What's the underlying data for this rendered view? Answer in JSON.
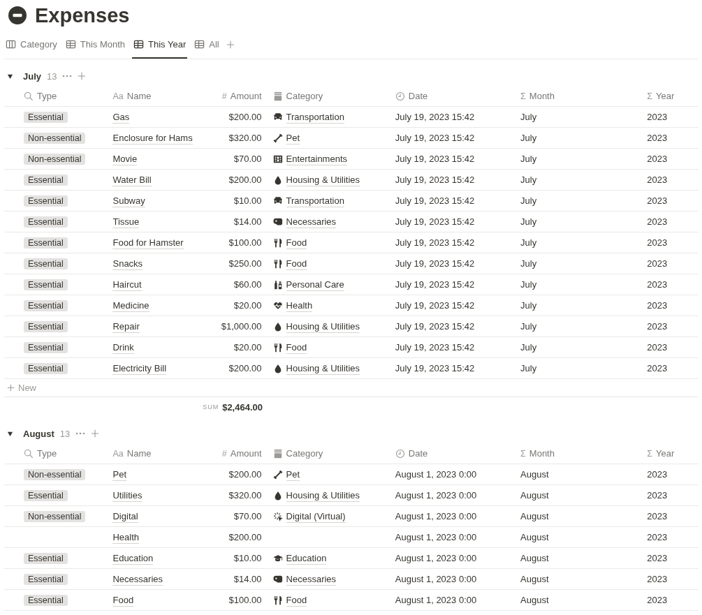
{
  "page": {
    "title": "Expenses"
  },
  "tabs": [
    {
      "label": "Category",
      "kind": "board",
      "selected": false
    },
    {
      "label": "This Month",
      "kind": "table",
      "selected": false
    },
    {
      "label": "This Year",
      "kind": "table",
      "selected": true
    },
    {
      "label": "All",
      "kind": "table",
      "selected": false
    }
  ],
  "groups": [
    {
      "title": "July",
      "count": "13",
      "expanded": true,
      "columns": [
        {
          "label": "Type",
          "kind": "search"
        },
        {
          "label": "Name",
          "kind": "text",
          "glyph": "Aa"
        },
        {
          "label": "Amount",
          "kind": "number",
          "glyph": "#"
        },
        {
          "label": "Category",
          "kind": "select"
        },
        {
          "label": "Date",
          "kind": "clock"
        },
        {
          "label": "Month",
          "kind": "formula",
          "glyph": "Σ"
        },
        {
          "label": "Year",
          "kind": "formula",
          "glyph": "Σ"
        }
      ],
      "new_label": "New",
      "sum": {
        "label": "SUM",
        "value": "$2,464.00"
      },
      "rows": [
        {
          "type": "Essential",
          "name": "Gas",
          "amount": "$200.00",
          "category": {
            "label": "Transportation",
            "kind": "car"
          },
          "date": "July 19, 2023 15:42",
          "month": "July",
          "year": "2023"
        },
        {
          "type": "Non-essential",
          "name": "Enclosure for Hams",
          "amount": "$320.00",
          "category": {
            "label": "Pet",
            "kind": "bone"
          },
          "date": "July 19, 2023 15:42",
          "month": "July",
          "year": "2023"
        },
        {
          "type": "Non-essential",
          "name": "Movie",
          "amount": "$70.00",
          "category": {
            "label": "Entertainments",
            "kind": "film"
          },
          "date": "July 19, 2023 15:42",
          "month": "July",
          "year": "2023"
        },
        {
          "type": "Essential",
          "name": "Water Bill",
          "amount": "$200.00",
          "category": {
            "label": "Housing & Utilities",
            "kind": "drop"
          },
          "date": "July 19, 2023 15:42",
          "month": "July",
          "year": "2023"
        },
        {
          "type": "Essential",
          "name": "Subway",
          "amount": "$10.00",
          "category": {
            "label": "Transportation",
            "kind": "car"
          },
          "date": "July 19, 2023 15:42",
          "month": "July",
          "year": "2023"
        },
        {
          "type": "Essential",
          "name": "Tissue",
          "amount": "$14.00",
          "category": {
            "label": "Necessaries",
            "kind": "roll"
          },
          "date": "July 19, 2023 15:42",
          "month": "July",
          "year": "2023"
        },
        {
          "type": "Essential",
          "name": "Food for Hamster",
          "amount": "$100.00",
          "category": {
            "label": "Food",
            "kind": "cutlery"
          },
          "date": "July 19, 2023 15:42",
          "month": "July",
          "year": "2023"
        },
        {
          "type": "Essential",
          "name": "Snacks",
          "amount": "$250.00",
          "category": {
            "label": "Food",
            "kind": "cutlery"
          },
          "date": "July 19, 2023 15:42",
          "month": "July",
          "year": "2023"
        },
        {
          "type": "Essential",
          "name": "Haircut",
          "amount": "$60.00",
          "category": {
            "label": "Personal Care",
            "kind": "bottles"
          },
          "date": "July 19, 2023 15:42",
          "month": "July",
          "year": "2023"
        },
        {
          "type": "Essential",
          "name": "Medicine",
          "amount": "$20.00",
          "category": {
            "label": "Health",
            "kind": "heart"
          },
          "date": "July 19, 2023 15:42",
          "month": "July",
          "year": "2023"
        },
        {
          "type": "Essential",
          "name": "Repair",
          "amount": "$1,000.00",
          "category": {
            "label": "Housing & Utilities",
            "kind": "drop"
          },
          "date": "July 19, 2023 15:42",
          "month": "July",
          "year": "2023"
        },
        {
          "type": "Essential",
          "name": "Drink",
          "amount": "$20.00",
          "category": {
            "label": "Food",
            "kind": "cutlery"
          },
          "date": "July 19, 2023 15:42",
          "month": "July",
          "year": "2023"
        },
        {
          "type": "Essential",
          "name": "Electricity Bill",
          "amount": "$200.00",
          "category": {
            "label": "Housing & Utilities",
            "kind": "drop"
          },
          "date": "July 19, 2023 15:42",
          "month": "July",
          "year": "2023"
        }
      ]
    },
    {
      "title": "August",
      "count": "13",
      "expanded": true,
      "columns": [
        {
          "label": "Type",
          "kind": "search"
        },
        {
          "label": "Name",
          "kind": "text",
          "glyph": "Aa"
        },
        {
          "label": "Amount",
          "kind": "number",
          "glyph": "#"
        },
        {
          "label": "Category",
          "kind": "select"
        },
        {
          "label": "Date",
          "kind": "clock"
        },
        {
          "label": "Month",
          "kind": "formula",
          "glyph": "Σ"
        },
        {
          "label": "Year",
          "kind": "formula",
          "glyph": "Σ"
        }
      ],
      "rows": [
        {
          "type": "Non-essential",
          "name": "Pet",
          "amount": "$200.00",
          "category": {
            "label": "Pet",
            "kind": "bone"
          },
          "date": "August 1, 2023 0:00",
          "month": "August",
          "year": "2023"
        },
        {
          "type": "Essential",
          "name": "Utilities",
          "amount": "$320.00",
          "category": {
            "label": "Housing & Utilities",
            "kind": "drop"
          },
          "date": "August 1, 2023 0:00",
          "month": "August",
          "year": "2023"
        },
        {
          "type": "Non-essential",
          "name": "Digital",
          "amount": "$70.00",
          "category": {
            "label": "Digital (Virtual)",
            "kind": "sparkle"
          },
          "date": "August 1, 2023 0:00",
          "month": "August",
          "year": "2023"
        },
        {
          "name": "Health",
          "amount": "$200.00",
          "date": "August 1, 2023 0:00",
          "month": "August",
          "year": "2023"
        },
        {
          "type": "Essential",
          "name": "Education",
          "amount": "$10.00",
          "category": {
            "label": "Education",
            "kind": "cap"
          },
          "date": "August 1, 2023 0:00",
          "month": "August",
          "year": "2023"
        },
        {
          "type": "Essential",
          "name": "Necessaries",
          "amount": "$14.00",
          "category": {
            "label": "Necessaries",
            "kind": "roll"
          },
          "date": "August 1, 2023 0:00",
          "month": "August",
          "year": "2023"
        },
        {
          "type": "Essential",
          "name": "Food",
          "amount": "$100.00",
          "category": {
            "label": "Food",
            "kind": "cutlery"
          },
          "date": "August 1, 2023 0:00",
          "month": "August",
          "year": "2023"
        }
      ]
    }
  ]
}
